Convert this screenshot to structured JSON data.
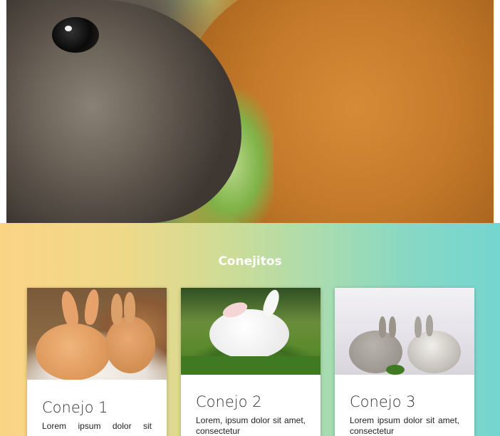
{
  "hero": {
    "image": "bunnies-kissing-photo"
  },
  "section": {
    "title": "Conejitos",
    "colors": {
      "start": "#fbd485",
      "end": "#74d6d0"
    }
  },
  "cards": [
    {
      "image": "orange-bunnies-photo",
      "title": "Conejo 1",
      "text": "Lorem ipsum dolor sit"
    },
    {
      "image": "white-bunny-grass-photo",
      "title": "Conejo 2",
      "text": "Lorem, ipsum dolor sit amet, consectetur"
    },
    {
      "image": "grey-bunnies-photo",
      "title": "Conejo 3",
      "text": "Lorem ipsum dolor sit amet, consectetur"
    }
  ]
}
